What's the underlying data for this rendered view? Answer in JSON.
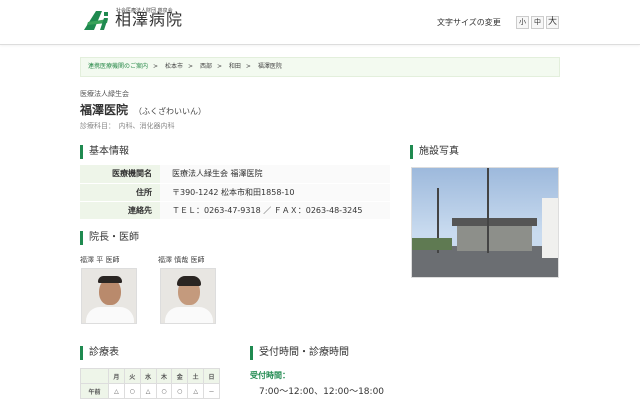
{
  "header": {
    "logo_sub": "社会医療法人財団 慈泉会",
    "logo_name": "相澤病院",
    "font_size_label": "文字サイズの変更",
    "font_sizes": [
      "小",
      "中",
      "大"
    ]
  },
  "breadcrumb": [
    "連携医療機関のご案内",
    "松本市",
    "西部",
    "和田",
    "福澤医院"
  ],
  "breadcrumb_sep": ">",
  "clinic": {
    "corp": "医療法人緑生会",
    "name": "福澤医院",
    "kana": "（ふくざわいいん）",
    "dept": "診療科目：　内科、消化器内科"
  },
  "sections": {
    "basic": "基本情報",
    "doctors": "院長・医師",
    "photo": "施設写真",
    "schedule": "診療表",
    "hours": "受付時間・診療時間"
  },
  "info": [
    {
      "k": "医療機関名",
      "v": "医療法人緑生会 福澤医院"
    },
    {
      "k": "住所",
      "v": "〒390-1242 松本市和田1858-10"
    },
    {
      "k": "連絡先",
      "v": "ＴＥＬ：0263-47-9318 ／ ＦＡＸ：0263-48-3245"
    }
  ],
  "doctors": [
    "福澤 平 医師",
    "福澤 慎哉 医師"
  ],
  "schedule": {
    "days": [
      "月",
      "火",
      "水",
      "木",
      "金",
      "土",
      "日"
    ],
    "rows": [
      {
        "label": "午前",
        "marks": [
          "△",
          "○",
          "△",
          "○",
          "○",
          "△",
          "－"
        ]
      }
    ]
  },
  "hours": {
    "label": "受付時間：",
    "value": "7:00～12:00、12:00～18:00"
  },
  "colors": {
    "accent": "#1f8a50",
    "table_key_bg": "#eef5e9"
  }
}
